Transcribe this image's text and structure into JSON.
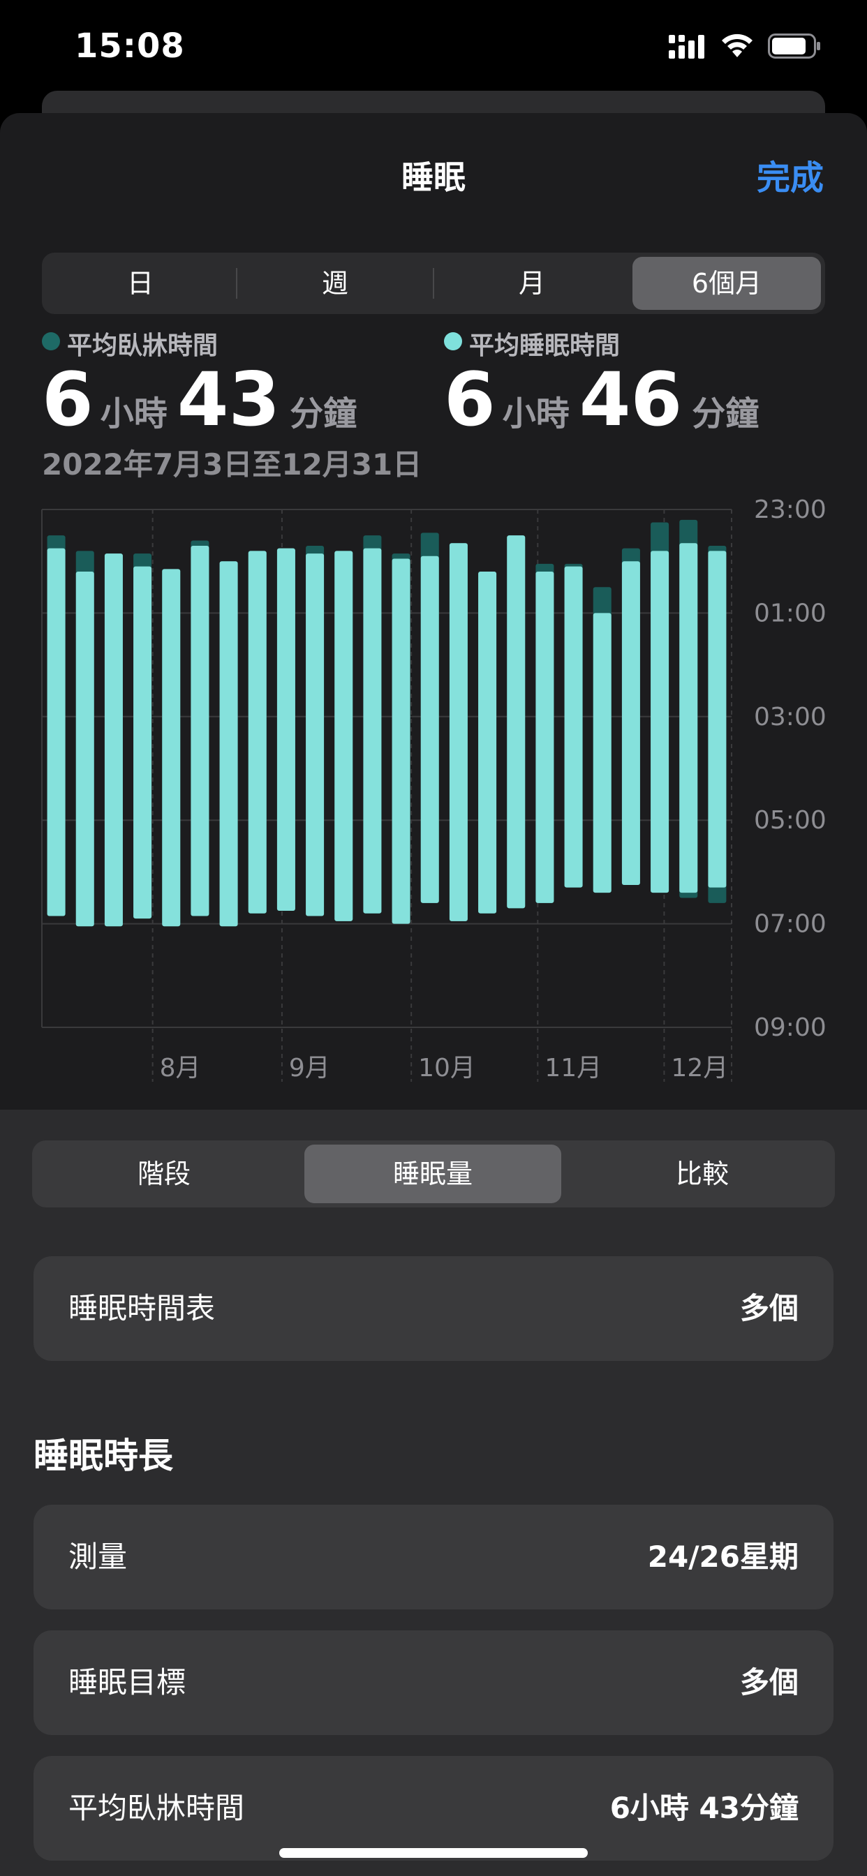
{
  "status": {
    "time": "15:08"
  },
  "header": {
    "title": "睡眠",
    "done_label": "完成"
  },
  "range_tabs": [
    {
      "label": "日",
      "selected": false
    },
    {
      "label": "週",
      "selected": false
    },
    {
      "label": "月",
      "selected": false
    },
    {
      "label": "6個月",
      "selected": true
    }
  ],
  "summary": {
    "in_bed": {
      "label": "平均臥牀時間",
      "hours": "6",
      "hours_unit": "小時",
      "minutes": "43",
      "minutes_unit": "分鐘",
      "color": "#1e6a66"
    },
    "asleep": {
      "label": "平均睡眠時間",
      "hours": "6",
      "hours_unit": "小時",
      "minutes": "46",
      "minutes_unit": "分鐘",
      "color": "#7fe0dc"
    },
    "date_range": "2022年7月3日至12月31日"
  },
  "chart_data": {
    "type": "bar",
    "y_ticks": [
      "23:00",
      "01:00",
      "03:00",
      "05:00",
      "07:00",
      "09:00"
    ],
    "x_ticks": [
      "8月",
      "9月",
      "10月",
      "11月",
      "12月"
    ],
    "x_tick_positions": [
      4,
      8.5,
      13,
      17.4,
      21.8
    ],
    "ylim_hours": [
      23,
      33
    ],
    "inbed_color": "#1a5c59",
    "asleep_color": "#85e1dc",
    "weeks": [
      {
        "inbed": [
          23.5,
          30.85
        ],
        "asleep": [
          23.75,
          30.85
        ]
      },
      {
        "inbed": [
          23.8,
          31.05
        ],
        "asleep": [
          24.2,
          31.05
        ]
      },
      {
        "inbed": [
          23.85,
          31.05
        ],
        "asleep": [
          23.85,
          31.05
        ]
      },
      {
        "inbed": [
          23.85,
          30.9
        ],
        "asleep": [
          24.1,
          30.9
        ]
      },
      {
        "inbed": [
          24.15,
          31.05
        ],
        "asleep": [
          24.15,
          31.05
        ]
      },
      {
        "inbed": [
          23.6,
          30.85
        ],
        "asleep": [
          23.7,
          30.85
        ]
      },
      {
        "inbed": [
          24.0,
          31.05
        ],
        "asleep": [
          24.0,
          31.05
        ]
      },
      {
        "inbed": [
          23.8,
          30.8
        ],
        "asleep": [
          23.8,
          30.8
        ]
      },
      {
        "inbed": [
          23.75,
          30.75
        ],
        "asleep": [
          23.75,
          30.75
        ]
      },
      {
        "inbed": [
          23.7,
          30.85
        ],
        "asleep": [
          23.85,
          30.85
        ]
      },
      {
        "inbed": [
          23.8,
          30.95
        ],
        "asleep": [
          23.8,
          30.95
        ]
      },
      {
        "inbed": [
          23.5,
          30.8
        ],
        "asleep": [
          23.75,
          30.8
        ]
      },
      {
        "inbed": [
          23.85,
          31.0
        ],
        "asleep": [
          23.95,
          31.0
        ]
      },
      {
        "inbed": [
          23.45,
          30.6
        ],
        "asleep": [
          23.9,
          30.6
        ]
      },
      {
        "inbed": [
          23.65,
          30.95
        ],
        "asleep": [
          23.65,
          30.95
        ]
      },
      {
        "inbed": [
          24.2,
          30.8
        ],
        "asleep": [
          24.2,
          30.8
        ]
      },
      {
        "inbed": [
          23.5,
          30.7
        ],
        "asleep": [
          23.5,
          30.7
        ]
      },
      {
        "inbed": [
          24.05,
          30.6
        ],
        "asleep": [
          24.2,
          30.6
        ]
      },
      {
        "inbed": [
          24.05,
          30.3
        ],
        "asleep": [
          24.1,
          30.3
        ]
      },
      {
        "inbed": [
          24.5,
          30.4
        ],
        "asleep": [
          25.0,
          30.4
        ]
      },
      {
        "inbed": [
          23.75,
          30.25
        ],
        "asleep": [
          24.0,
          30.25
        ]
      },
      {
        "inbed": [
          23.25,
          30.4
        ],
        "asleep": [
          23.8,
          30.4
        ]
      },
      {
        "inbed": [
          23.2,
          30.5
        ],
        "asleep": [
          23.65,
          30.4
        ]
      },
      {
        "inbed": [
          23.7,
          30.6
        ],
        "asleep": [
          23.8,
          30.3
        ]
      }
    ]
  },
  "view_tabs": [
    {
      "label": "階段",
      "selected": false
    },
    {
      "label": "睡眠量",
      "selected": true
    },
    {
      "label": "比較",
      "selected": false
    }
  ],
  "schedule_row": {
    "label": "睡眠時間表",
    "value": "多個"
  },
  "section_title": "睡眠時長",
  "rows": [
    {
      "label": "測量",
      "value": "24/26星期"
    },
    {
      "label": "睡眠目標",
      "value": "多個"
    },
    {
      "label": "平均臥牀時間",
      "value": "6小時 43分鐘"
    }
  ]
}
